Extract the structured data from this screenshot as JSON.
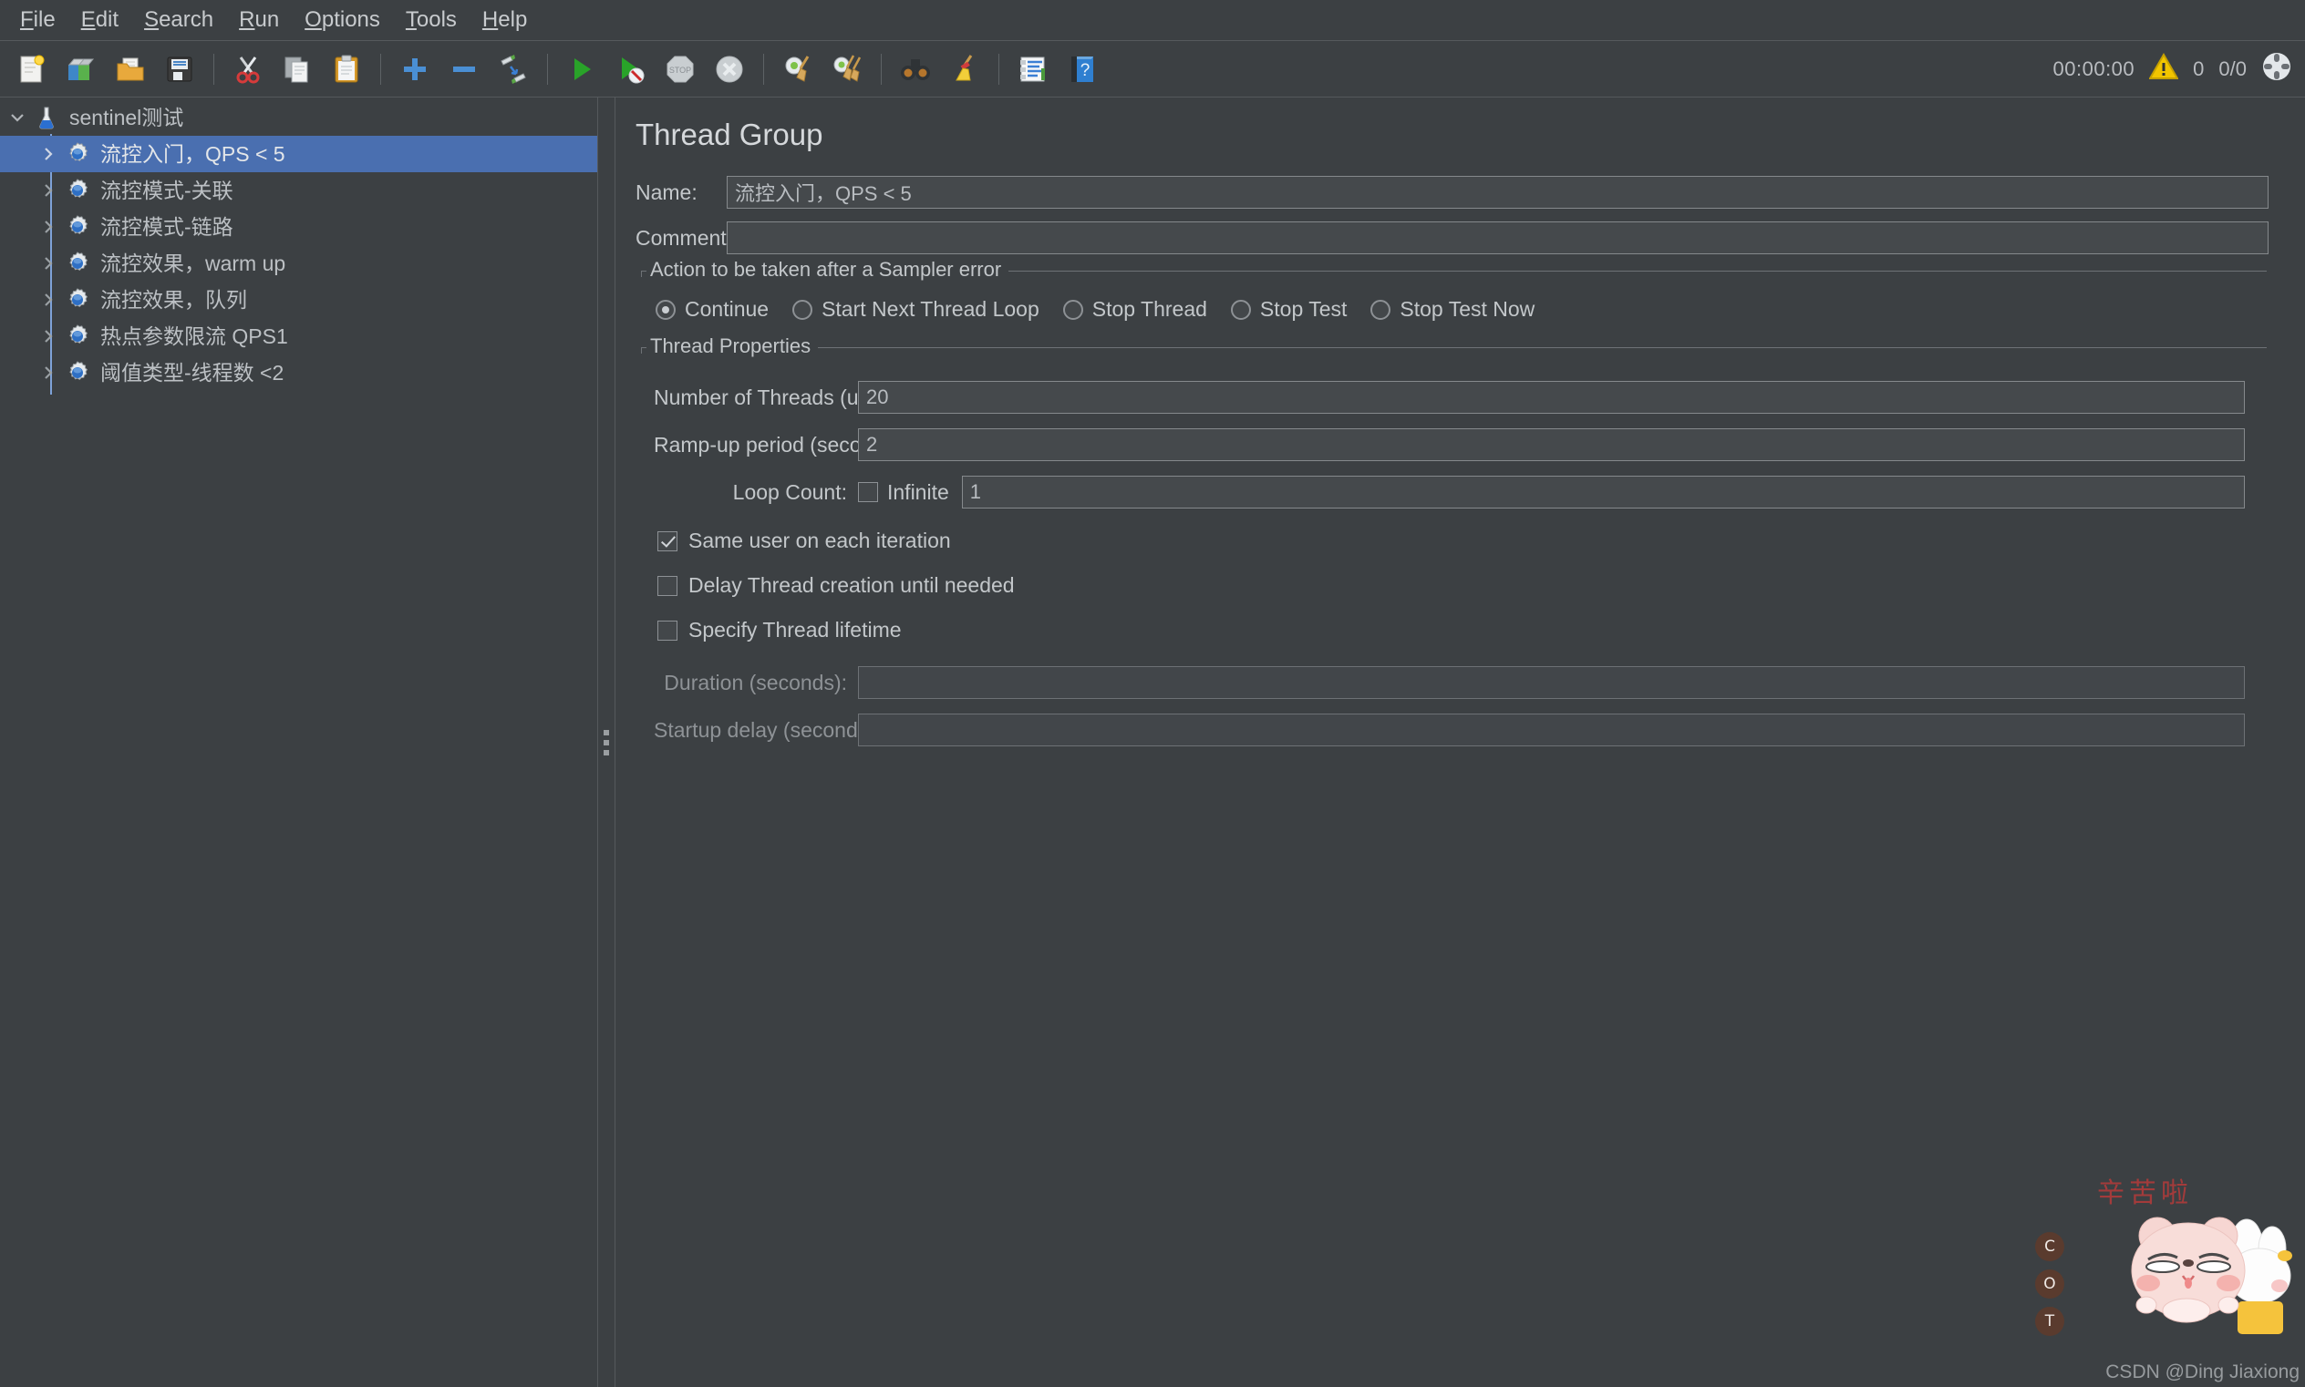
{
  "menubar": {
    "items": [
      {
        "label": "File",
        "mnemonic": "F"
      },
      {
        "label": "Edit",
        "mnemonic": "E"
      },
      {
        "label": "Search",
        "mnemonic": "S"
      },
      {
        "label": "Run",
        "mnemonic": "R"
      },
      {
        "label": "Options",
        "mnemonic": "O"
      },
      {
        "label": "Tools",
        "mnemonic": "T"
      },
      {
        "label": "Help",
        "mnemonic": "H"
      }
    ]
  },
  "toolbar": {
    "buttons": [
      {
        "icon": "new-test-plan-icon",
        "label": "New"
      },
      {
        "icon": "templates-icon",
        "label": "Templates"
      },
      {
        "icon": "open-folder-icon",
        "label": "Open"
      },
      {
        "icon": "save-floppy-icon",
        "label": "Save"
      },
      {
        "icon": "cut-scissors-icon",
        "label": "Cut"
      },
      {
        "icon": "copy-pages-icon",
        "label": "Copy"
      },
      {
        "icon": "paste-clipboard-icon",
        "label": "Paste"
      },
      {
        "icon": "expand-plus-icon",
        "label": "Expand all"
      },
      {
        "icon": "collapse-minus-icon",
        "label": "Collapse all"
      },
      {
        "icon": "toggle-pencils-icon",
        "label": "Toggle"
      },
      {
        "icon": "start-play-icon",
        "label": "Start"
      },
      {
        "icon": "start-no-timers-icon",
        "label": "Start no pauses"
      },
      {
        "icon": "stop-octagon-icon",
        "label": "Stop"
      },
      {
        "icon": "shutdown-circle-icon",
        "label": "Shutdown"
      },
      {
        "icon": "clear-gear-broom-icon",
        "label": "Clear"
      },
      {
        "icon": "clear-all-brooms-icon",
        "label": "Clear all"
      },
      {
        "icon": "search-binoculars-icon",
        "label": "Search"
      },
      {
        "icon": "reset-search-broom-icon",
        "label": "Reset search"
      },
      {
        "icon": "function-helper-icon",
        "label": "Function helper"
      },
      {
        "icon": "help-book-icon",
        "label": "Help"
      }
    ],
    "status": {
      "timer": "00:00:00",
      "warning_icon": "warning-triangle-icon",
      "warning_count": "0",
      "thread_counts": "0/0",
      "activity_icon": "thread-activity-icon"
    }
  },
  "tree": {
    "root": {
      "label": "sentinel测试",
      "icon": "test-plan-flask-icon",
      "twisty": "chevron-down-icon",
      "expanded": true
    },
    "children": [
      {
        "label": "流控入门，QPS < 5",
        "icon": "thread-group-gear-icon",
        "twisty": "chevron-right-icon",
        "selected": true
      },
      {
        "label": "流控模式-关联",
        "icon": "thread-group-gear-icon",
        "twisty": "chevron-right-icon",
        "selected": false
      },
      {
        "label": "流控模式-链路",
        "icon": "thread-group-gear-icon",
        "twisty": "chevron-right-icon",
        "selected": false
      },
      {
        "label": "流控效果，warm up",
        "icon": "thread-group-gear-icon",
        "twisty": "chevron-right-icon",
        "selected": false
      },
      {
        "label": "流控效果，队列",
        "icon": "thread-group-gear-icon",
        "twisty": "chevron-right-icon",
        "selected": false
      },
      {
        "label": "热点参数限流 QPS1",
        "icon": "thread-group-gear-icon",
        "twisty": "chevron-right-icon",
        "selected": false
      },
      {
        "label": "阈值类型-线程数 <2",
        "icon": "thread-group-gear-icon",
        "twisty": "chevron-right-icon",
        "selected": false
      }
    ]
  },
  "main": {
    "title": "Thread Group",
    "name_label": "Name:",
    "name_value": "流控入门，QPS < 5",
    "comments_label": "Comments:",
    "comments_value": "",
    "sampler_error": {
      "title": "Action to be taken after a Sampler error",
      "options": [
        {
          "label": "Continue",
          "selected": true
        },
        {
          "label": "Start Next Thread Loop",
          "selected": false
        },
        {
          "label": "Stop Thread",
          "selected": false
        },
        {
          "label": "Stop Test",
          "selected": false
        },
        {
          "label": "Stop Test Now",
          "selected": false
        }
      ]
    },
    "thread_properties": {
      "title": "Thread Properties",
      "num_threads_label": "Number of Threads (users):",
      "num_threads_value": "20",
      "rampup_label": "Ramp-up period (seconds):",
      "rampup_value": "2",
      "loop_count_label": "Loop Count:",
      "infinite_label": "Infinite",
      "infinite_checked": false,
      "loop_count_value": "1",
      "same_user_label": "Same user on each iteration",
      "same_user_checked": true,
      "delay_thread_label": "Delay Thread creation until needed",
      "delay_thread_checked": false,
      "specify_lifetime_label": "Specify Thread lifetime",
      "specify_lifetime_checked": false,
      "duration_label": "Duration (seconds):",
      "duration_value": "",
      "duration_enabled": false,
      "startup_delay_label": "Startup delay (seconds):",
      "startup_delay_value": "",
      "startup_delay_enabled": false
    }
  },
  "watermark": {
    "chinese_text": "辛苦啦",
    "badges": [
      "C",
      "O",
      "T"
    ],
    "credit": "CSDN @Ding Jiaxiong"
  },
  "colors": {
    "background": "#3c4043",
    "selection": "#4a6fb0",
    "field_bg": "#45494c",
    "field_border": "#85898c",
    "text": "#c3c7ca",
    "accent_red": "#a33b3b"
  }
}
